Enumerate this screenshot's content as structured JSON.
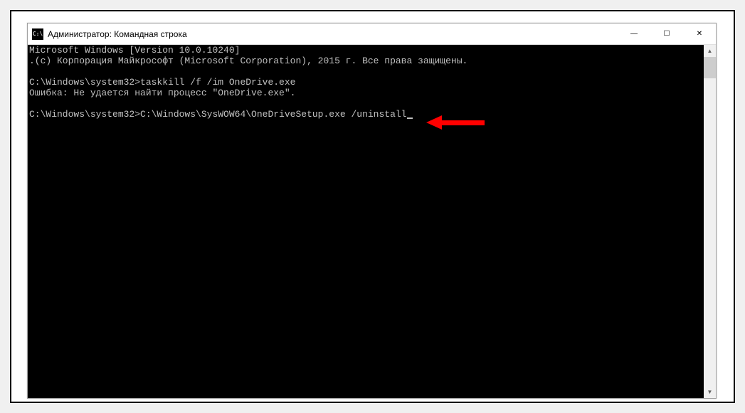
{
  "window": {
    "title": "Администратор: Командная строка",
    "icon_text": "C:\\"
  },
  "console": {
    "lines": [
      "Microsoft Windows [Version 10.0.10240]",
      ".(c) Корпорация Майкрософт (Microsoft Corporation), 2015 г. Все права защищены.",
      "",
      "C:\\Windows\\system32>taskkill /f /im OneDrive.exe",
      "Ошибка: Не удается найти процесс \"OneDrive.exe\".",
      "",
      "C:\\Windows\\system32>C:\\Windows\\SysWOW64\\OneDriveSetup.exe /uninstall"
    ]
  },
  "titlebar_buttons": {
    "minimize": "—",
    "maximize": "☐",
    "close": "✕"
  },
  "scrollbar": {
    "up": "▲",
    "down": "▼"
  }
}
